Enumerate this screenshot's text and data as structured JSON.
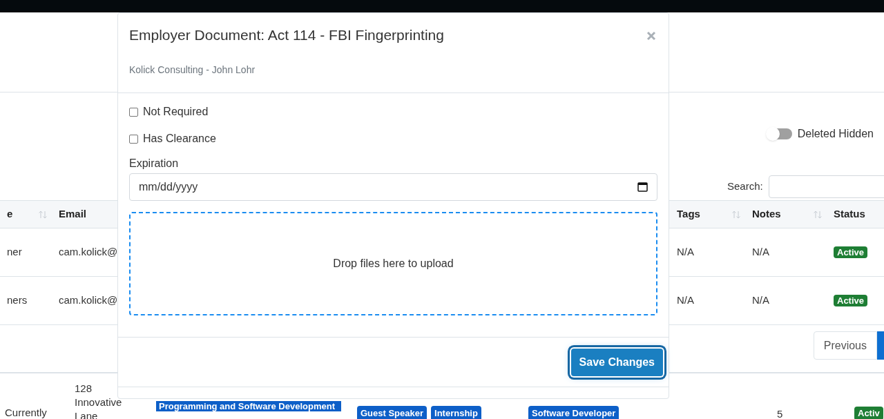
{
  "toggle": {
    "label": "Deleted Hidden",
    "on": false
  },
  "search": {
    "label": "Search:"
  },
  "table": {
    "columns": [
      {
        "label": "e",
        "sortable": true
      },
      {
        "label": "Email"
      },
      {
        "label": "Tags",
        "sortable": true
      },
      {
        "label": "Notes",
        "sortable": true
      },
      {
        "label": "Status"
      }
    ],
    "rows": [
      {
        "cells": [
          "ner",
          "cam.kolick@",
          "N/A",
          "N/A"
        ],
        "status": "Active"
      },
      {
        "cells": [
          "ners",
          "cam.kolick@",
          "N/A",
          "N/A"
        ],
        "status": "Active"
      }
    ]
  },
  "pagination": {
    "previous": "Previous"
  },
  "next_row": {
    "column_1": "Currently",
    "address": "128 Innovative Lane",
    "category": "Programming and Software Development",
    "tags": [
      "Guest Speaker",
      "Internship"
    ],
    "role_tags": [
      "Software Developer"
    ],
    "count": "5",
    "status": "Activ"
  },
  "modal": {
    "title": "Employer Document: Act 114 - FBI Fingerprinting",
    "subtitle": "Kolick Consulting - John Lohr",
    "checkboxes": [
      {
        "label": "Not Required",
        "checked": false
      },
      {
        "label": "Has Clearance",
        "checked": false
      }
    ],
    "expiration": {
      "label": "Expiration",
      "placeholder": "mm/dd/yyyy"
    },
    "dropzone": "Drop files here to upload",
    "save_button": "Save Changes"
  }
}
